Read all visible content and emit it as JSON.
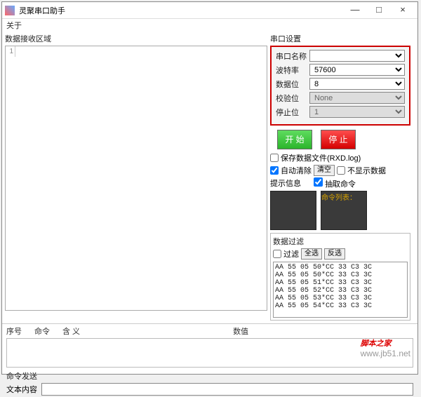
{
  "window": {
    "title": "灵聚串口助手",
    "min": "—",
    "max": "□",
    "close": "×"
  },
  "menu": {
    "about": "关于"
  },
  "recv": {
    "label": "数据接收区域",
    "gutter": "1"
  },
  "port": {
    "group": "串口设置",
    "name_lbl": "串口名称",
    "name_val": "",
    "baud_lbl": "波特率",
    "baud_val": "57600",
    "databits_lbl": "数据位",
    "databits_val": "8",
    "parity_lbl": "校验位",
    "parity_val": "None",
    "stopbits_lbl": "停止位",
    "stopbits_val": "1"
  },
  "controls": {
    "start": "开  始",
    "stop": "停  止",
    "savefile": "保存数据文件(RXD.log)",
    "autoclear": "自动清除",
    "clearbtn": "清空",
    "noshow": "不显示数据",
    "hint_lbl": "提示信息",
    "extract_lbl": "抽取命令",
    "cmdlist": "命令列表："
  },
  "filter": {
    "group": "数据过滤",
    "filter_lbl": "过滤",
    "selall": "全选",
    "invert": "反选",
    "lines": [
      "AA 55 05 50*CC 33 C3 3C",
      "AA 55 05 50*CC 33 C3 3C",
      "AA 55 05 51*CC 33 C3 3C",
      "AA 55 05 52*CC 33 C3 3C",
      "AA 55 05 53*CC 33 C3 3C",
      "AA 55 05 54*CC 33 C3 3C"
    ]
  },
  "lower": {
    "seq": "序号",
    "cmd": "命令",
    "meaning": "含  义",
    "value": "数值"
  },
  "send": {
    "group": "命令发送",
    "text_lbl": "文本内容"
  },
  "watermark": {
    "text": "脚本之家",
    "url": "www.jb51.net"
  }
}
